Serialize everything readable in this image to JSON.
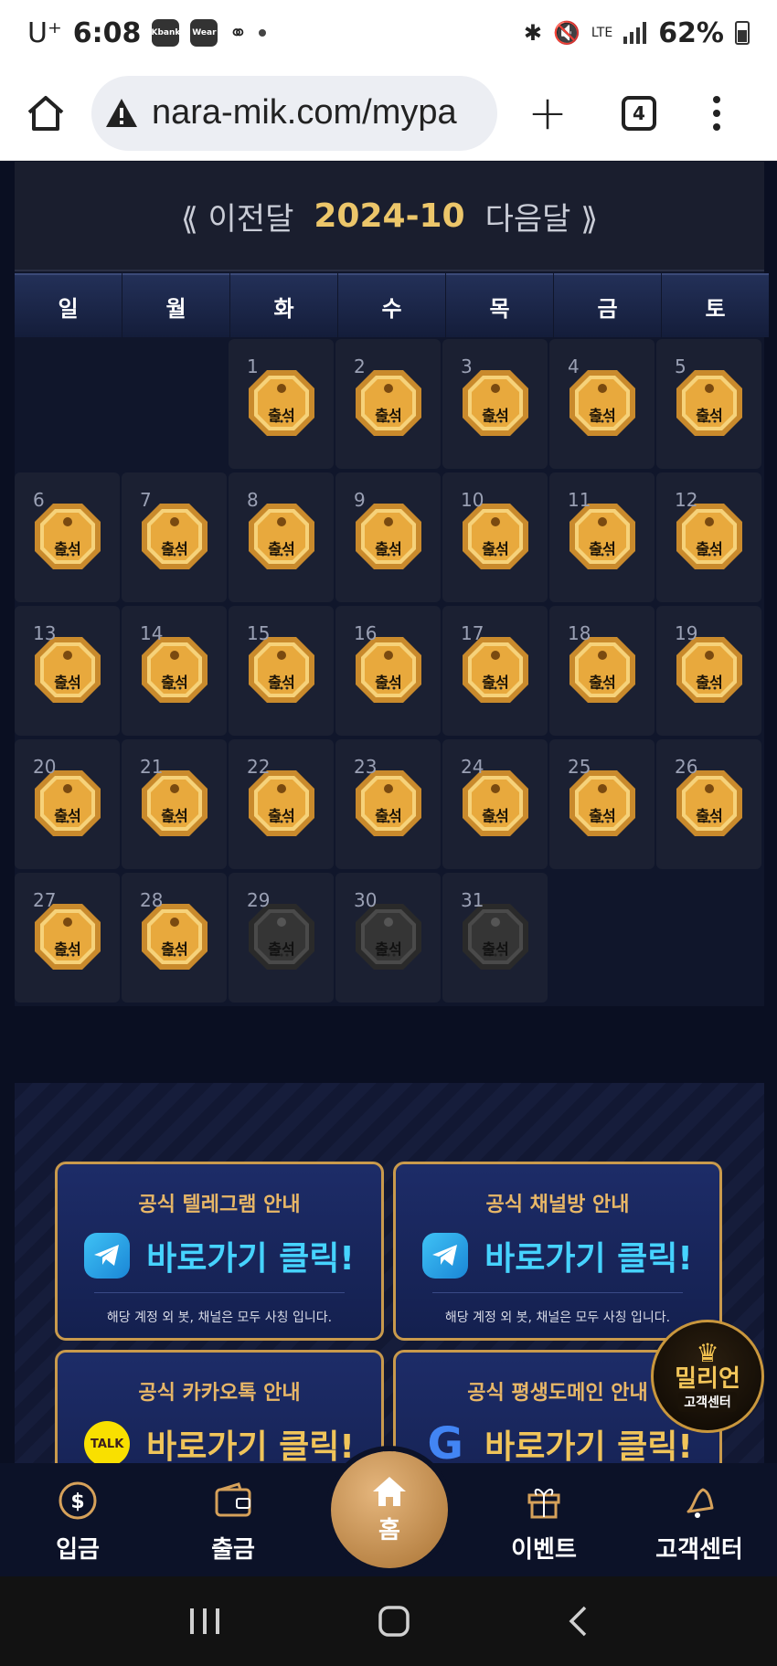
{
  "status_bar": {
    "carrier": "U⁺",
    "time": "6:08",
    "app_icons": [
      "Kbank",
      "Wear"
    ],
    "battery": "62%",
    "network": "LTE"
  },
  "browser": {
    "url": "nara-mik.com/mypa",
    "tab_count": "4"
  },
  "calendar": {
    "prev_label": "⟪ 이전달",
    "current_month": "2024-10",
    "next_label": "다음달 ⟫",
    "weekdays": [
      "일",
      "월",
      "화",
      "수",
      "목",
      "금",
      "토"
    ],
    "stamp_label": "출석",
    "days": [
      {
        "day": "1",
        "attended": true
      },
      {
        "day": "2",
        "attended": true
      },
      {
        "day": "3",
        "attended": true
      },
      {
        "day": "4",
        "attended": true
      },
      {
        "day": "5",
        "attended": true
      },
      {
        "day": "6",
        "attended": true
      },
      {
        "day": "7",
        "attended": true
      },
      {
        "day": "8",
        "attended": true
      },
      {
        "day": "9",
        "attended": true
      },
      {
        "day": "10",
        "attended": true
      },
      {
        "day": "11",
        "attended": true
      },
      {
        "day": "12",
        "attended": true
      },
      {
        "day": "13",
        "attended": true
      },
      {
        "day": "14",
        "attended": true
      },
      {
        "day": "15",
        "attended": true
      },
      {
        "day": "16",
        "attended": true
      },
      {
        "day": "17",
        "attended": true
      },
      {
        "day": "18",
        "attended": true
      },
      {
        "day": "19",
        "attended": true
      },
      {
        "day": "20",
        "attended": true
      },
      {
        "day": "21",
        "attended": true
      },
      {
        "day": "22",
        "attended": true
      },
      {
        "day": "23",
        "attended": true
      },
      {
        "day": "24",
        "attended": true
      },
      {
        "day": "25",
        "attended": true
      },
      {
        "day": "26",
        "attended": true
      },
      {
        "day": "27",
        "attended": true
      },
      {
        "day": "28",
        "attended": true
      },
      {
        "day": "29",
        "attended": false
      },
      {
        "day": "30",
        "attended": false
      },
      {
        "day": "31",
        "attended": false
      }
    ],
    "leading_blanks": 2
  },
  "banners": [
    {
      "title": "공식 텔레그램 안내",
      "action": "바로가기 클릭!",
      "subtitle": "해당 계정 외 봇, 채널은 모두 사칭 입니다.",
      "logo": "telegram-icon"
    },
    {
      "title": "공식 채널방 안내",
      "action": "바로가기 클릭!",
      "subtitle": "해당 계정 외 봇, 채널은 모두 사칭 입니다.",
      "logo": "telegram-icon"
    },
    {
      "title": "공식 카카오톡 안내",
      "action": "바로가기 클릭!",
      "logo_text": "TALK",
      "logo": "kakaotalk-icon"
    },
    {
      "title": "공식 평생도메인 안내",
      "action": "바로가기 클릭!",
      "logo_text": "G",
      "logo": "google-icon"
    }
  ],
  "support_badge": {
    "name": "밀리언",
    "sub": "고객센터"
  },
  "bottom_nav": {
    "deposit": "입금",
    "withdraw": "출금",
    "home": "홈",
    "event": "이벤트",
    "support": "고객센터"
  },
  "colors": {
    "gold": "#ecc66a",
    "navy": "#0a0f22",
    "cyan": "#46d3ff"
  }
}
